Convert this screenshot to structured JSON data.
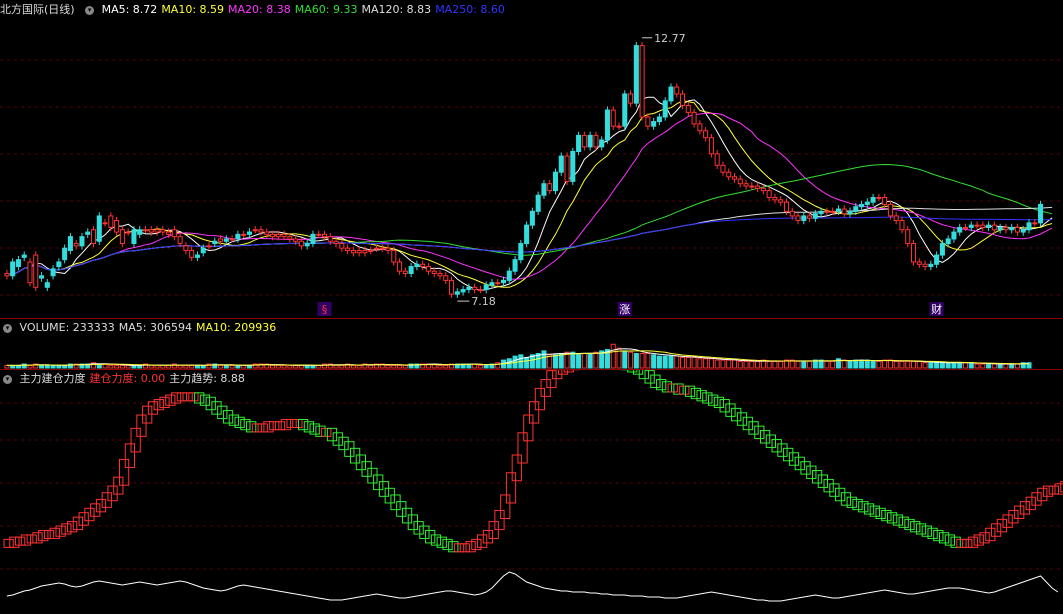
{
  "header": {
    "stock_title": "北方国际(日线)",
    "ma_items": [
      {
        "label": "MA5: 8.72",
        "color": "#ffffff"
      },
      {
        "label": "MA10: 8.59",
        "color": "#ffff33"
      },
      {
        "label": "MA20: 8.38",
        "color": "#ff33ff"
      },
      {
        "label": "MA60: 9.33",
        "color": "#33dd33"
      },
      {
        "label": "MA120: 8.83",
        "color": "#dddddd"
      },
      {
        "label": "MA250: 8.60",
        "color": "#3333ff"
      }
    ]
  },
  "volume_header": {
    "items": [
      {
        "label": "VOLUME: 233333",
        "color": "#dddddd"
      },
      {
        "label": "MA5: 306594",
        "color": "#dddddd"
      },
      {
        "label": "MA10: 209936",
        "color": "#ffff33"
      }
    ]
  },
  "indicator_header": {
    "items": [
      {
        "label": "主力建仓力度",
        "color": "#dddddd"
      },
      {
        "label": "建仓力度: 0.00",
        "color": "#ff3333"
      },
      {
        "label": "主力趋势: 8.88",
        "color": "#dddddd"
      }
    ]
  },
  "markers": [
    {
      "text": "§",
      "index": 55,
      "color": "#ff3333"
    },
    {
      "text": "涨",
      "index": 107,
      "color": "#ffffff"
    },
    {
      "text": "财",
      "index": 161,
      "color": "#ffffff"
    }
  ],
  "annotations": {
    "high_label": "12.77",
    "low_label": "7.18"
  },
  "colors": {
    "up": "#ff3333",
    "down": "#33dddd",
    "grid": "#550000",
    "separator": "#8a0000"
  },
  "chart_data": [
    {
      "type": "candlestick",
      "name": "price",
      "ylim": [
        6.9,
        13.2
      ],
      "closes": [
        7.65,
        7.6,
        7.8,
        8.0,
        7.9,
        8.05,
        7.55,
        7.35,
        7.6,
        7.8,
        7.95,
        8.15,
        8.3,
        8.25,
        8.5,
        8.6,
        8.35,
        8.75,
        8.9,
        8.8,
        8.6,
        8.55,
        8.3,
        8.5,
        8.6,
        8.6,
        8.6,
        8.6,
        8.55,
        8.6,
        8.45,
        8.25,
        8.15,
        8.0,
        8.1,
        8.25,
        8.3,
        8.4,
        8.35,
        8.4,
        8.4,
        8.5,
        8.5,
        8.6,
        8.6,
        8.55,
        8.5,
        8.5,
        8.5,
        8.45,
        8.4,
        8.35,
        8.25,
        8.3,
        8.5,
        8.5,
        8.45,
        8.35,
        8.3,
        8.2,
        8.15,
        8.15,
        8.15,
        8.15,
        8.2,
        8.2,
        8.2,
        8.15,
        7.9,
        7.7,
        7.65,
        7.8,
        7.85,
        7.8,
        7.7,
        7.65,
        7.6,
        7.5,
        7.2,
        7.25,
        7.3,
        7.35,
        7.3,
        7.3,
        7.4,
        7.45,
        7.45,
        7.5,
        7.7,
        7.95,
        8.3,
        8.7,
        9.0,
        9.35,
        9.6,
        9.45,
        9.85,
        10.2,
        9.65,
        10.3,
        10.65,
        10.4,
        10.65,
        10.4,
        10.55,
        11.2,
        10.85,
        10.85,
        11.55,
        11.35,
        12.6,
        11.05,
        10.85,
        10.95,
        11.05,
        11.4,
        11.7,
        11.55,
        11.3,
        11.15,
        10.9,
        10.75,
        10.6,
        10.25,
        10.0,
        9.85,
        9.75,
        9.7,
        9.6,
        9.55,
        9.55,
        9.5,
        9.45,
        9.3,
        9.25,
        9.2,
        9.0,
        8.9,
        8.8,
        8.9,
        8.85,
        8.95,
        9.0,
        9.0,
        9.0,
        9.05,
        8.95,
        9.0,
        9.1,
        9.15,
        9.2,
        9.3,
        9.3,
        9.15,
        8.9,
        8.8,
        8.6,
        8.3,
        7.9,
        7.85,
        7.8,
        7.85,
        8.05,
        8.3,
        8.4,
        8.55,
        8.65,
        8.65,
        8.7,
        8.7,
        8.65,
        8.7,
        8.6,
        8.65,
        8.6,
        8.65,
        8.55,
        8.6,
        8.75,
        8.75,
        9.15,
        9.05
      ],
      "opens": [
        7.6,
        7.9,
        7.95,
        8.05,
        7.45,
        7.35,
        7.6,
        7.45,
        7.75,
        7.9,
        8.2,
        8.45,
        8.25,
        8.45,
        8.55,
        8.3,
        8.9,
        8.75,
        8.65,
        8.55,
        8.3,
        8.55,
        8.6,
        8.6,
        8.6,
        8.55,
        8.55,
        8.55,
        8.5,
        8.45,
        8.3,
        8.15,
        8.0,
        8.05,
        8.2,
        8.25,
        8.35,
        8.35,
        8.4,
        8.4,
        8.5,
        8.5,
        8.55,
        8.6,
        8.55,
        8.5,
        8.45,
        8.45,
        8.45,
        8.4,
        8.35,
        8.25,
        8.3,
        8.5,
        8.5,
        8.45,
        8.35,
        8.3,
        8.2,
        8.15,
        8.1,
        8.1,
        8.1,
        8.15,
        8.2,
        8.2,
        8.15,
        7.9,
        7.7,
        7.65,
        7.8,
        7.85,
        7.8,
        7.7,
        7.65,
        7.6,
        7.5,
        7.2,
        7.25,
        7.3,
        7.35,
        7.3,
        7.3,
        7.4,
        7.45,
        7.45,
        7.5,
        7.7,
        7.95,
        8.3,
        8.7,
        9.0,
        9.35,
        9.6,
        9.45,
        9.85,
        10.2,
        9.65,
        10.3,
        10.65,
        10.4,
        10.65,
        10.4,
        10.55,
        11.2,
        10.85,
        10.85,
        11.55,
        11.35,
        12.6,
        11.05,
        10.85,
        10.95,
        11.05,
        11.4,
        11.7,
        11.55,
        11.3,
        11.15,
        10.9,
        10.75,
        10.6,
        10.25,
        10.0,
        9.85,
        9.75,
        9.7,
        9.6,
        9.55,
        9.55,
        9.5,
        9.45,
        9.3,
        9.25,
        9.2,
        9.0,
        8.9,
        8.8,
        8.9,
        8.85,
        8.95,
        9.0,
        9.0,
        9.0,
        9.05,
        8.95,
        9.0,
        9.1,
        9.15,
        9.2,
        9.3,
        9.3,
        9.15,
        8.9,
        8.8,
        8.6,
        8.3,
        7.9,
        7.85,
        7.8,
        7.85,
        8.05,
        8.3,
        8.4,
        8.55,
        8.65,
        8.65,
        8.7,
        8.7,
        8.65,
        8.7,
        8.6,
        8.65,
        8.6,
        8.65,
        8.55,
        8.6,
        8.75,
        8.75,
        9.15
      ]
    },
    {
      "type": "bar",
      "name": "volume",
      "values": [
        2,
        2,
        2,
        3,
        2,
        3,
        2,
        2,
        2,
        2,
        2,
        3,
        3,
        3,
        3,
        4,
        3,
        3,
        2,
        2,
        2,
        2,
        2,
        2,
        3,
        2,
        2,
        2,
        2,
        3,
        2,
        2,
        2,
        2,
        2,
        3,
        3,
        2,
        2,
        2,
        2,
        2,
        2,
        3,
        3,
        3,
        2,
        2,
        2,
        2,
        2,
        2,
        2,
        2,
        2,
        3,
        3,
        2,
        2,
        3,
        2,
        2,
        3,
        2,
        3,
        3,
        2,
        2,
        2,
        2,
        3,
        3,
        3,
        3,
        3,
        2,
        2,
        3,
        3,
        3,
        3,
        3,
        2,
        2,
        3,
        4,
        6,
        7,
        9,
        10,
        8,
        10,
        11,
        13,
        10,
        10,
        11,
        12,
        12,
        10,
        11,
        11,
        12,
        13,
        14,
        18,
        15,
        13,
        12,
        11,
        11,
        11,
        10,
        9,
        9,
        9,
        9,
        8,
        8,
        8,
        7,
        7,
        7,
        6,
        6,
        6,
        6,
        5,
        5,
        5,
        5,
        6,
        5,
        5,
        5,
        6,
        6,
        5,
        5,
        5,
        6,
        6,
        5,
        5,
        7,
        6,
        5,
        6,
        6,
        6,
        5,
        5,
        6,
        6,
        5,
        5,
        5,
        5,
        5,
        4,
        4,
        4,
        4,
        4,
        4,
        4,
        4,
        4,
        3,
        3,
        3,
        3,
        3,
        3,
        3,
        3,
        4,
        4
      ],
      "ylim": [
        0,
        22
      ]
    },
    {
      "type": "step-area",
      "name": "主力趋势",
      "values": [
        12,
        13,
        13,
        14,
        14,
        15,
        16,
        16,
        17,
        18,
        19,
        20,
        22,
        24,
        26,
        28,
        30,
        33,
        36,
        40,
        48,
        55,
        62,
        68,
        72,
        74,
        75,
        76,
        77,
        78,
        78,
        78,
        78,
        77,
        76,
        74,
        72,
        70,
        68,
        67,
        66,
        65,
        64,
        64,
        64,
        65,
        65,
        65,
        66,
        66,
        66,
        65,
        64,
        63,
        62,
        62,
        60,
        58,
        56,
        53,
        50,
        47,
        44,
        41,
        38,
        35,
        32,
        29,
        26,
        23,
        20,
        18,
        16,
        14,
        13,
        12,
        11,
        10,
        10,
        10,
        11,
        12,
        14,
        16,
        20,
        25,
        32,
        42,
        50,
        60,
        68,
        74,
        80,
        84,
        88,
        90,
        91,
        92,
        93,
        94,
        95,
        95,
        96,
        96,
        95,
        94,
        93,
        92,
        91,
        90,
        88,
        86,
        84,
        83,
        82,
        82,
        81,
        81,
        80,
        79,
        78,
        77,
        76,
        75,
        73,
        71,
        69,
        67,
        65,
        63,
        61,
        59,
        57,
        55,
        53,
        51,
        49,
        47,
        45,
        43,
        41,
        39,
        37,
        35,
        33,
        31,
        30,
        29,
        28,
        27,
        26,
        25,
        24,
        23,
        22,
        21,
        20,
        19,
        18,
        17,
        16,
        15,
        14,
        13,
        12,
        12,
        12,
        13,
        14,
        15,
        17,
        19,
        21,
        23,
        25,
        27,
        29,
        31,
        33,
        35,
        36,
        36,
        37,
        38,
        39,
        40,
        44,
        48,
        52,
        58,
        64
      ],
      "ylim": [
        0,
        100
      ]
    },
    {
      "type": "bar",
      "name": "建仓力度",
      "values": [
        0,
        0,
        0,
        0,
        0,
        0,
        0,
        0,
        0,
        0,
        0,
        0,
        0,
        0,
        0,
        0,
        0,
        0,
        0,
        0,
        0,
        0,
        0,
        0,
        0,
        0,
        0,
        0,
        0,
        0,
        0,
        0,
        0,
        0,
        0,
        0,
        0,
        0,
        0,
        0,
        0,
        0,
        0,
        0,
        0,
        0,
        0,
        0,
        0,
        0,
        0,
        0,
        0,
        0,
        0,
        0,
        0,
        0,
        0,
        0,
        0,
        0,
        0,
        0,
        0,
        0,
        0,
        0,
        0,
        0,
        0,
        0,
        0,
        0,
        0,
        0,
        0,
        0,
        0,
        0,
        0,
        0,
        0,
        0,
        0,
        0,
        0,
        0,
        0,
        0,
        0,
        0,
        0,
        0,
        0,
        0,
        0,
        0,
        0,
        0,
        0,
        0,
        0,
        0,
        0,
        0,
        0,
        0,
        0,
        0,
        0,
        0,
        0,
        0,
        0,
        0,
        0,
        0,
        0,
        0,
        0,
        0,
        0,
        0,
        0,
        0,
        0,
        0,
        0,
        0,
        0,
        0,
        0,
        0,
        0,
        0,
        0,
        0,
        0,
        0,
        0,
        0,
        0,
        0,
        0,
        0,
        0,
        0,
        0,
        0,
        0,
        0,
        0,
        0,
        0,
        0,
        0,
        0,
        0,
        0,
        0,
        0,
        0,
        0,
        0,
        0,
        0,
        0,
        0,
        0,
        0,
        0,
        0,
        0,
        0,
        0,
        0,
        0,
        0,
        0,
        0,
        0,
        0,
        0,
        0,
        0,
        0,
        0
      ],
      "ylim": [
        0,
        100
      ]
    },
    {
      "type": "line",
      "name": "white-oscillator",
      "values": [
        10,
        11,
        13,
        15,
        16,
        18,
        20,
        21,
        22,
        23,
        22,
        20,
        19,
        20,
        22,
        24,
        25,
        24,
        23,
        22,
        21,
        22,
        23,
        24,
        23,
        22,
        21,
        22,
        23,
        24,
        25,
        24,
        22,
        20,
        18,
        17,
        16,
        15,
        16,
        18,
        20,
        21,
        20,
        19,
        18,
        17,
        16,
        15,
        14,
        13,
        12,
        11,
        10,
        9,
        8,
        7,
        6,
        6,
        6,
        7,
        8,
        9,
        10,
        11,
        12,
        11,
        10,
        9,
        8,
        8,
        9,
        10,
        11,
        12,
        13,
        14,
        15,
        15,
        14,
        13,
        12,
        11,
        12,
        14,
        18,
        24,
        30,
        34,
        32,
        28,
        24,
        22,
        20,
        18,
        17,
        16,
        15,
        15,
        14,
        14,
        14,
        13,
        13,
        12,
        12,
        11,
        11,
        11,
        10,
        10,
        10,
        9,
        9,
        9,
        8,
        8,
        8,
        9,
        10,
        11,
        12,
        13,
        14,
        13,
        12,
        11,
        10,
        9,
        8,
        7,
        6,
        6,
        5,
        5,
        5,
        6,
        7,
        8,
        9,
        10,
        11,
        10,
        9,
        8,
        8,
        9,
        10,
        11,
        12,
        13,
        14,
        15,
        16,
        15,
        14,
        13,
        12,
        12,
        13,
        14,
        15,
        16,
        17,
        18,
        18,
        18,
        17,
        16,
        15,
        14,
        13,
        14,
        16,
        18,
        20,
        22,
        24,
        26,
        28,
        30,
        24,
        18,
        14
      ],
      "ylim": [
        0,
        60
      ]
    }
  ]
}
